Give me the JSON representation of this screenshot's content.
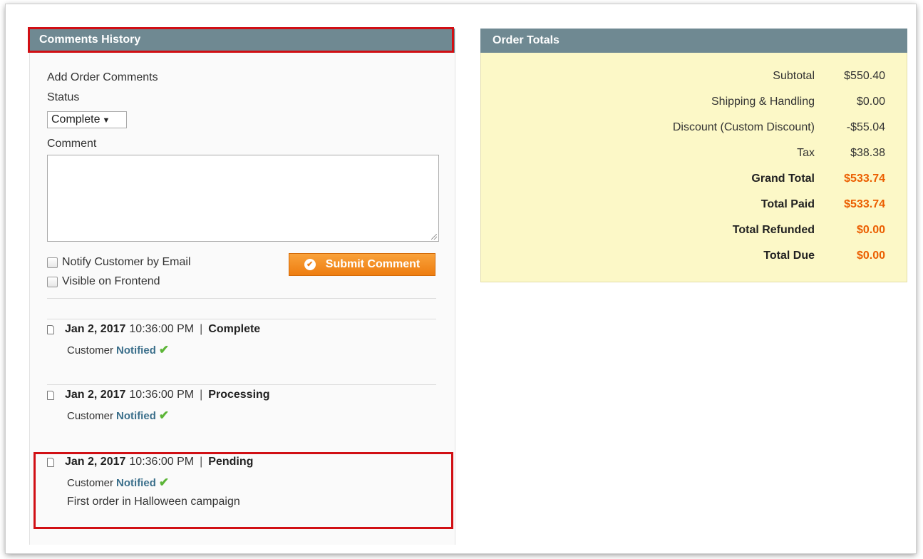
{
  "comments_history": {
    "title": "Comments History",
    "add_label": "Add Order Comments",
    "status_label": "Status",
    "status_value": "Complete",
    "comment_label": "Comment",
    "comment_value": "",
    "notify_label": "Notify Customer by Email",
    "visible_label": "Visible on Frontend",
    "submit_label": "Submit Comment",
    "entries": [
      {
        "date": "Jan 2, 2017",
        "time": "10:36:00 PM",
        "sep": "|",
        "status": "Complete",
        "customer": "Customer",
        "notified": "Notified",
        "note": ""
      },
      {
        "date": "Jan 2, 2017",
        "time": "10:36:00 PM",
        "sep": "|",
        "status": "Processing",
        "customer": "Customer",
        "notified": "Notified",
        "note": ""
      },
      {
        "date": "Jan 2, 2017",
        "time": "10:36:00 PM",
        "sep": "|",
        "status": "Pending",
        "customer": "Customer",
        "notified": "Notified",
        "note": "First order in Halloween campaign"
      }
    ]
  },
  "order_totals": {
    "title": "Order Totals",
    "rows": [
      {
        "label": "Subtotal",
        "value": "$550.40"
      },
      {
        "label": "Shipping & Handling",
        "value": "$0.00"
      },
      {
        "label": "Discount (Custom Discount)",
        "value": "-$55.04"
      },
      {
        "label": "Tax",
        "value": "$38.38"
      },
      {
        "label": "Grand Total",
        "value": "$533.74"
      },
      {
        "label": "Total Paid",
        "value": "$533.74"
      },
      {
        "label": "Total Refunded",
        "value": "$0.00"
      },
      {
        "label": "Total Due",
        "value": "$0.00"
      }
    ]
  },
  "colors": {
    "header": "#6f8992",
    "accent_orange": "#eb5e00",
    "highlight_red": "#d10f14",
    "totals_bg": "#fcf8c7",
    "notified_blue": "#3b6f8b",
    "check_green": "#5cb537"
  },
  "icons": {
    "submit": "check-circle-icon",
    "entry": "document-icon",
    "notified": "checkmark-icon",
    "dropdown": "chevron-down-icon"
  }
}
